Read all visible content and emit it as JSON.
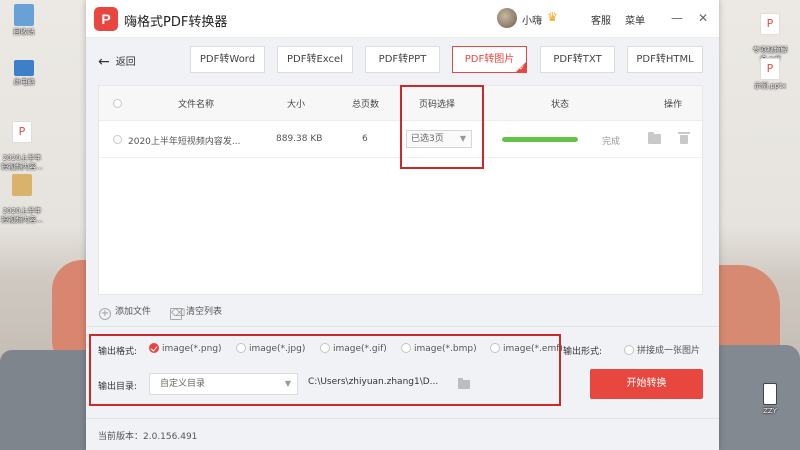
{
  "desktop": {
    "icons_left": [
      {
        "label": "回收站",
        "color": "#6aa0d8"
      },
      {
        "label": "此电脑",
        "color": "#3d7fc9"
      },
      {
        "label": "2020上半年\n短视频内容...",
        "color": "#e14d45"
      },
      {
        "label": "2020上半年\n短视频内容...",
        "color": "#d9b36b"
      }
    ],
    "icons_right": [
      {
        "label": "专项视频解\n说.pdf",
        "color": "#e14d45"
      },
      {
        "label": "示例.pptx",
        "color": "#e14d45"
      },
      {
        "label": "ZZY",
        "color": "#3a3a3a"
      }
    ]
  },
  "window": {
    "title": "嗨格式PDF转换器",
    "logo_text": "P",
    "user_name": "小嗨",
    "crown_icon": "crown-icon",
    "support_label": "客服",
    "menu_label": "菜单",
    "minimize": "—",
    "close": "✕"
  },
  "toolbar": {
    "back_label": "返回",
    "tabs": [
      {
        "label": "PDF转Word",
        "active": false
      },
      {
        "label": "PDF转Excel",
        "active": false
      },
      {
        "label": "PDF转PPT",
        "active": false
      },
      {
        "label": "PDF转图片",
        "active": true
      },
      {
        "label": "PDF转TXT",
        "active": false
      },
      {
        "label": "PDF转HTML",
        "active": false
      }
    ]
  },
  "table": {
    "headers": {
      "name": "文件名称",
      "size": "大小",
      "pages": "总页数",
      "page_select": "页码选择",
      "status": "状态",
      "action": "操作"
    },
    "rows": [
      {
        "name": "2020上半年短视频内容发...",
        "size": "889.38 KB",
        "pages": "6",
        "page_select": "已选3页",
        "progress": 1.0,
        "status": "完成"
      }
    ]
  },
  "file_actions": {
    "add_label": "添加文件",
    "clear_label": "清空列表"
  },
  "output": {
    "format_label": "输出格式:",
    "formats": [
      {
        "label": "image(*.png)",
        "selected": true
      },
      {
        "label": "image(*.jpg)",
        "selected": false
      },
      {
        "label": "image(*.gif)",
        "selected": false
      },
      {
        "label": "image(*.bmp)",
        "selected": false
      },
      {
        "label": "image(*.emf)",
        "selected": false
      }
    ],
    "form_label": "输出形式:",
    "merge_label": "拼接成一张图片",
    "dir_label": "输出目录:",
    "dir_select": "自定义目录",
    "dir_path": "C:\\Users\\zhiyuan.zhang1\\D...",
    "start_label": "开始转换"
  },
  "footer": {
    "version": "当前版本：2.0.156.491"
  },
  "colors": {
    "accent": "#e8473f",
    "progress": "#62c445",
    "highlight": "#cc2a2a"
  }
}
